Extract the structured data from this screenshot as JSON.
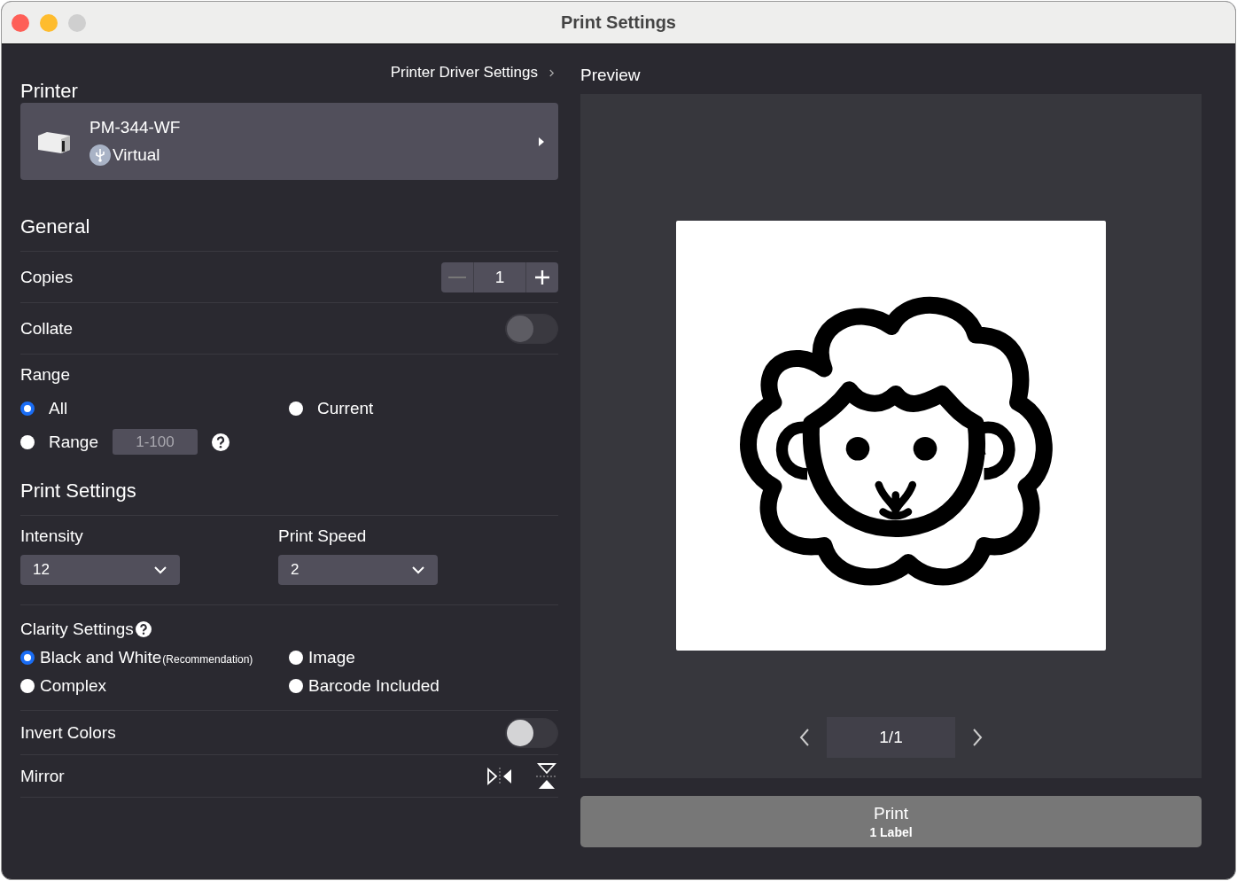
{
  "window": {
    "title": "Print Settings"
  },
  "driver_link": "Printer Driver Settings",
  "printer": {
    "heading": "Printer",
    "name": "PM-344-WF",
    "connection": "Virtual"
  },
  "general": {
    "heading": "General",
    "copies": {
      "label": "Copies",
      "value": "1"
    },
    "collate": {
      "label": "Collate",
      "on": false,
      "disabled": true
    },
    "range": {
      "label": "Range",
      "options": [
        {
          "label": "All",
          "selected": true
        },
        {
          "label": "Current",
          "selected": false
        }
      ],
      "custom": {
        "label": "Range",
        "selected": false,
        "placeholder": "1-100"
      }
    }
  },
  "print_settings": {
    "heading": "Print Settings",
    "selects": [
      {
        "label": "Intensity",
        "value": "12"
      },
      {
        "label": "Print Speed",
        "value": "2"
      }
    ],
    "clarity": {
      "label": "Clarity Settings",
      "options": [
        {
          "label": "Black and White",
          "note": "(Recommendation)",
          "selected": true
        },
        {
          "label": "Image",
          "selected": false
        },
        {
          "label": "Complex",
          "selected": false
        },
        {
          "label": "Barcode Included",
          "selected": false
        }
      ]
    },
    "invert": {
      "label": "Invert Colors",
      "on": false,
      "disabled": false
    },
    "mirror": {
      "label": "Mirror"
    }
  },
  "preview": {
    "heading": "Preview",
    "page": "1/1"
  },
  "print_button": {
    "label": "Print",
    "sub": "1 Label"
  }
}
